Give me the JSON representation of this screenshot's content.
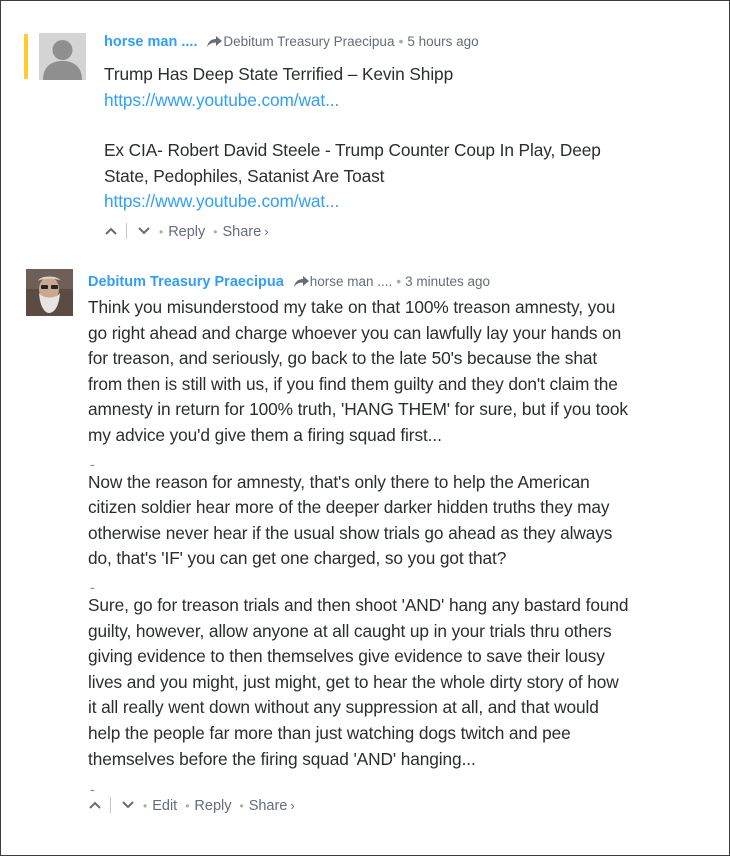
{
  "comment1": {
    "author": "horse man ....",
    "reply_to": "Debitum Treasury Praecipua",
    "separator": "•",
    "time": "5 hours ago",
    "lines": [
      "Trump Has Deep State Terrified – Kevin Shipp"
    ],
    "link1": "https://www.youtube.com/wat...",
    "lines2": [
      "Ex CIA- Robert David Steele - Trump Counter Coup In Play, Deep",
      "State, Pedophiles, Satanist Are Toast"
    ],
    "link2": "https://www.youtube.com/wat...",
    "footer": {
      "reply": "Reply",
      "share": "Share",
      "share_chevron": "›",
      "dot": "•"
    }
  },
  "comment2": {
    "author": "Debitum Treasury Praecipua",
    "reply_to": "horse man ....",
    "separator": "•",
    "time": "3 minutes ago",
    "para1": [
      "Think you misunderstood my take on that 100% treason amnesty, you",
      "go right ahead and charge whoever you can lawfully lay your hands on",
      "for treason, and seriously, go back to the late 50's because the shat",
      "from then is still with us, if you find them guilty and they don't claim the",
      "amnesty in return for 100% truth, 'HANG THEM' for sure, but if you took",
      "my advice you'd give them a firing squad first..."
    ],
    "dash": "-",
    "para2": [
      "Now the reason for amnesty, that's only there to help the American",
      "citizen soldier hear more of the deeper darker hidden truths they may",
      "otherwise never hear if the usual show trials go ahead as they always",
      "do, that's 'IF' you can get one charged, so you got that?"
    ],
    "para3": [
      "Sure, go for treason trials and then shoot 'AND' hang any bastard found",
      "guilty, however, allow anyone at all caught up in your trials thru others",
      "giving evidence to then themselves give evidence to save their lousy",
      "lives and you might, just might, get to hear the whole dirty story of how",
      "it all really went down without any suppression at all, and that would",
      "help the people far more than just watching dogs twitch and pee",
      "themselves before the firing squad 'AND' hanging..."
    ],
    "footer": {
      "edit": "Edit",
      "reply": "Reply",
      "share": "Share",
      "share_chevron": "›",
      "dot": "•"
    }
  },
  "colors": {
    "author": "#2e9fff",
    "link": "#2e9fff",
    "text": "#2a2e2e",
    "meta": "#656c7a",
    "highlight": "#ffcc2b"
  }
}
